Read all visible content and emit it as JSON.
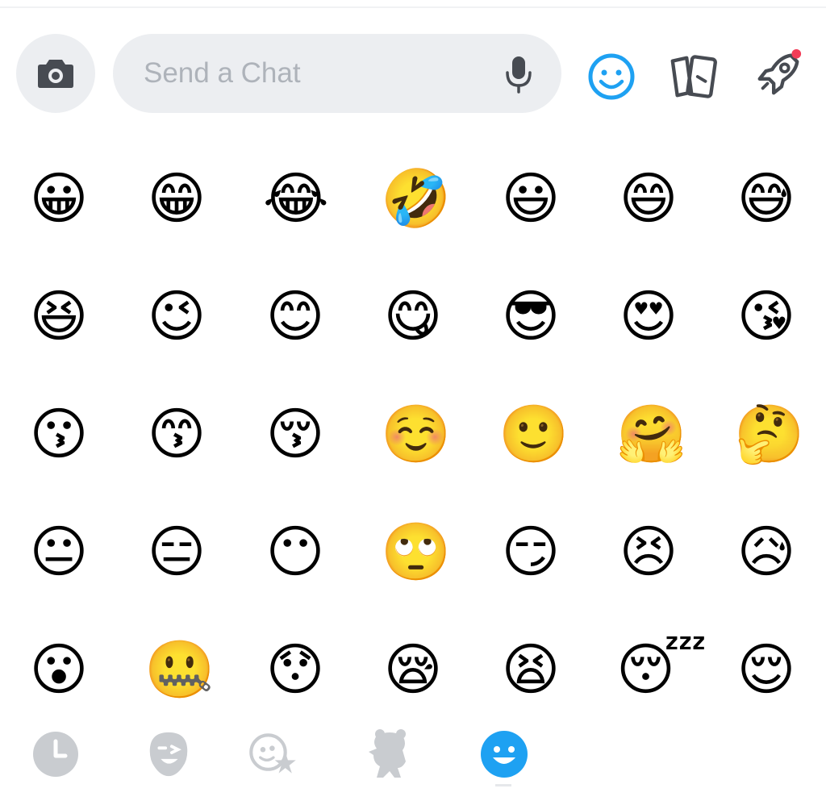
{
  "composer": {
    "placeholder": "Send a Chat",
    "camera_icon": "camera-icon",
    "mic_icon": "microphone-icon"
  },
  "top_icons": [
    {
      "name": "emoji-icon",
      "active": true,
      "color": "#1ea1f2"
    },
    {
      "name": "stickers-cards-icon",
      "active": false
    },
    {
      "name": "rocket-icon",
      "active": false,
      "badge_color": "#f23c57"
    }
  ],
  "emojis": [
    "😀",
    "😁",
    "😂",
    "🤣",
    "😃",
    "😄",
    "😅",
    "😆",
    "😉",
    "😊",
    "😋",
    "😎",
    "😍",
    "😘",
    "😗",
    "😙",
    "😚",
    "☺️",
    "🙂",
    "🤗",
    "🤔",
    "😐",
    "😑",
    "😶",
    "🙄",
    "😏",
    "😣",
    "😥",
    "😮",
    "🤐",
    "😯",
    "😪",
    "😫",
    "😴",
    "😌"
  ],
  "tabs": [
    {
      "name": "recent-clock-icon",
      "active": false
    },
    {
      "name": "bitmoji-wink-icon",
      "active": false
    },
    {
      "name": "bitmoji-star-icon",
      "active": false
    },
    {
      "name": "sticker-bear-icon",
      "active": false
    },
    {
      "name": "emoji-smiley-icon",
      "active": true,
      "color": "#1ea1f2"
    }
  ],
  "colors": {
    "accent": "#1ea1f2",
    "inactive_icon": "#c9ccd0",
    "field_bg": "#eceef1",
    "dark_icon": "#474b52",
    "placeholder": "#aeb3ba"
  }
}
